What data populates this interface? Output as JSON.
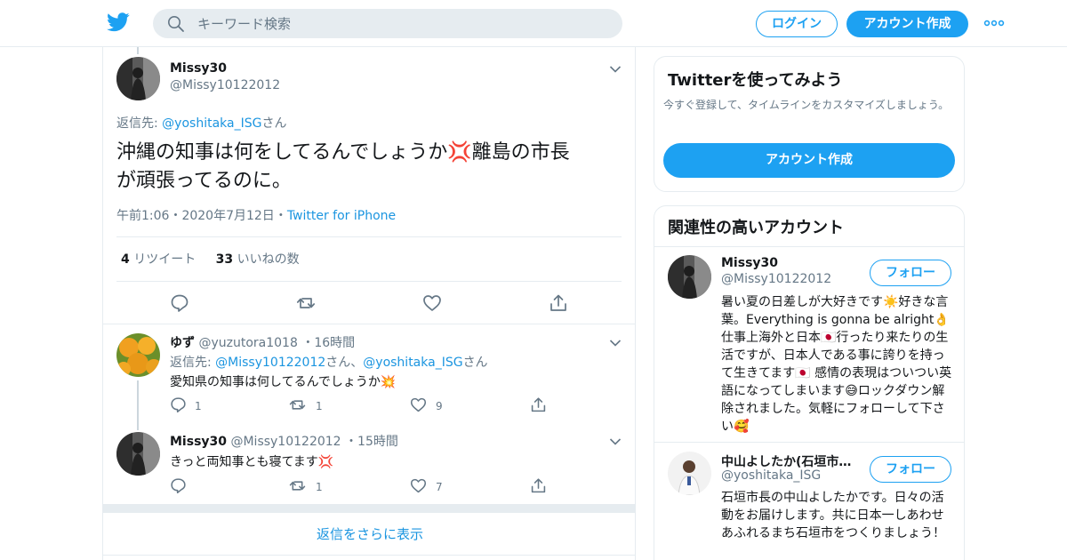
{
  "header": {
    "search_placeholder": "キーワード検索",
    "login_label": "ログイン",
    "signup_label": "アカウント作成",
    "brand_color": "#1da1f2"
  },
  "main_tweet": {
    "name": "Missy30",
    "handle": "@Missy10122012",
    "reply_prefix": "返信先:",
    "reply_to": "@yoshitaka_ISG",
    "reply_suffix": "さん",
    "text_line1a": "沖縄の知事は何をしてるんでしょうか",
    "text_line1b": "離島の市長",
    "text_line2": "が頑張ってるのに。",
    "emoji": "💢",
    "time": "午前1:06",
    "dot": "・",
    "date": "2020年7月12日",
    "source": "Twitter for iPhone",
    "retweets_count": "4",
    "retweets_label": "リツイート",
    "likes_count": "33",
    "likes_label": "いいねの数"
  },
  "replies": [
    {
      "name": "ゆず",
      "handle": "@yuzutora1018",
      "time": "16時間",
      "reply_prefix": "返信先:",
      "reply_to_1": "@Missy10122012",
      "reply_mid": "さん、",
      "reply_to_2": "@yoshitaka_ISG",
      "reply_suffix": "さん",
      "text": "愛知県の知事は何してるんでしょうか",
      "emoji": "💥",
      "reply_count": "1",
      "retweet_count": "1",
      "like_count": "9"
    },
    {
      "name": "Missy30",
      "handle": "@Missy10122012",
      "time": "15時間",
      "text": "きっと両知事とも寝てます",
      "emoji": "💢",
      "reply_count": "",
      "retweet_count": "1",
      "like_count": "7"
    }
  ],
  "show_more_label": "返信をさらに表示",
  "sidebar": {
    "try_title": "Twitterを使ってみよう",
    "try_sub": "今すぐ登録して、タイムラインをカスタマイズしましょう。",
    "try_button": "アカウント作成",
    "related_title": "関連性の高いアカウント",
    "follow_label": "フォロー",
    "accounts": [
      {
        "name": "Missy30",
        "handle": "@Missy10122012",
        "bio": "暑い夏の日差しが大好きです☀️好きな言葉。Everything is gonna be alright👌仕事上海外と日本🇯🇵行ったり来たりの生活ですが、日本人である事に誇りを持って生きてます🇯🇵 感情の表現はついつい英語になってしまいます😅ロックダウン解除されました。気軽にフォローして下さい🥰"
      },
      {
        "name": "中山よしたか(石垣市…",
        "handle": "@yoshitaka_ISG",
        "bio": "石垣市長の中山よしたかです。日々の活動をお届けします。共に日本一しあわせあふれるまち石垣市をつくりましょう！"
      }
    ]
  }
}
